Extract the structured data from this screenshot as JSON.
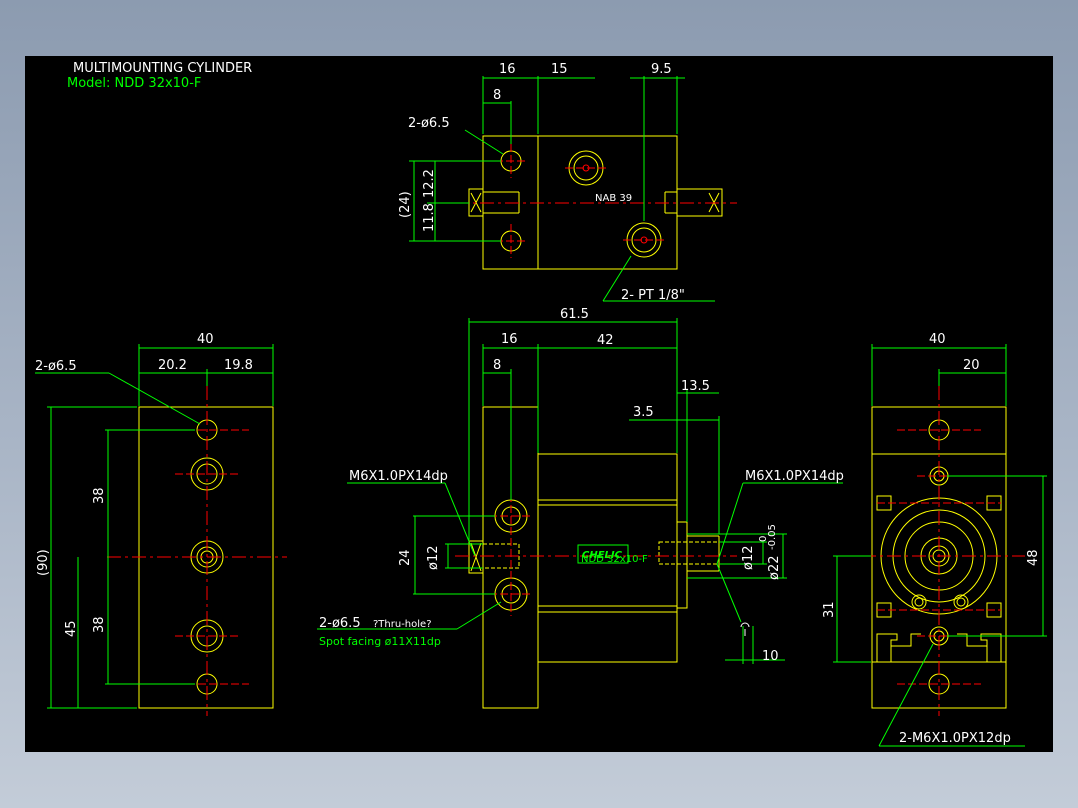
{
  "title_block": {
    "title": "MULTIMOUNTING CYLINDER",
    "model": "Model: NDD 32x10-F"
  },
  "colors": {
    "background": "#000000",
    "outline": "#ffff00",
    "dimension": "#00ff00",
    "centerline": "#ff0000",
    "dimension_text": "#ffffff"
  },
  "top_view": {
    "dims": [
      "16",
      "15",
      "9.5",
      "8",
      "12.2",
      "11.8",
      "(24)"
    ],
    "callout_holes": "2-ø6.5",
    "callout_port": "2- PT 1/8\"",
    "tiny_label": "NAB 39"
  },
  "left_view": {
    "dims": [
      "40",
      "20.2",
      "19.8",
      "38",
      "(90)",
      "38",
      "45"
    ],
    "callout_holes": "2-ø6.5"
  },
  "front_view": {
    "dims": [
      "61.5",
      "16",
      "42",
      "8",
      "13.5",
      "3.5",
      "24",
      "ø12",
      "ø12",
      "ø22",
      "0",
      "-0.05",
      "10"
    ],
    "callout_left_thread": "M6X1.0PX14dp",
    "callout_right_thread": "M6X1.0PX14dp",
    "callout_holes": "2-ø6.5",
    "callout_holes_note": "?Thru-hole?",
    "callout_spot": "Spot facing  ø11X11dp",
    "logo": "CHELIC",
    "logo_small": "NDD 32x10-F"
  },
  "right_view": {
    "dims": [
      "40",
      "20",
      "48",
      "31"
    ],
    "callout_thread": "2-M6X1.0PX12dp"
  }
}
